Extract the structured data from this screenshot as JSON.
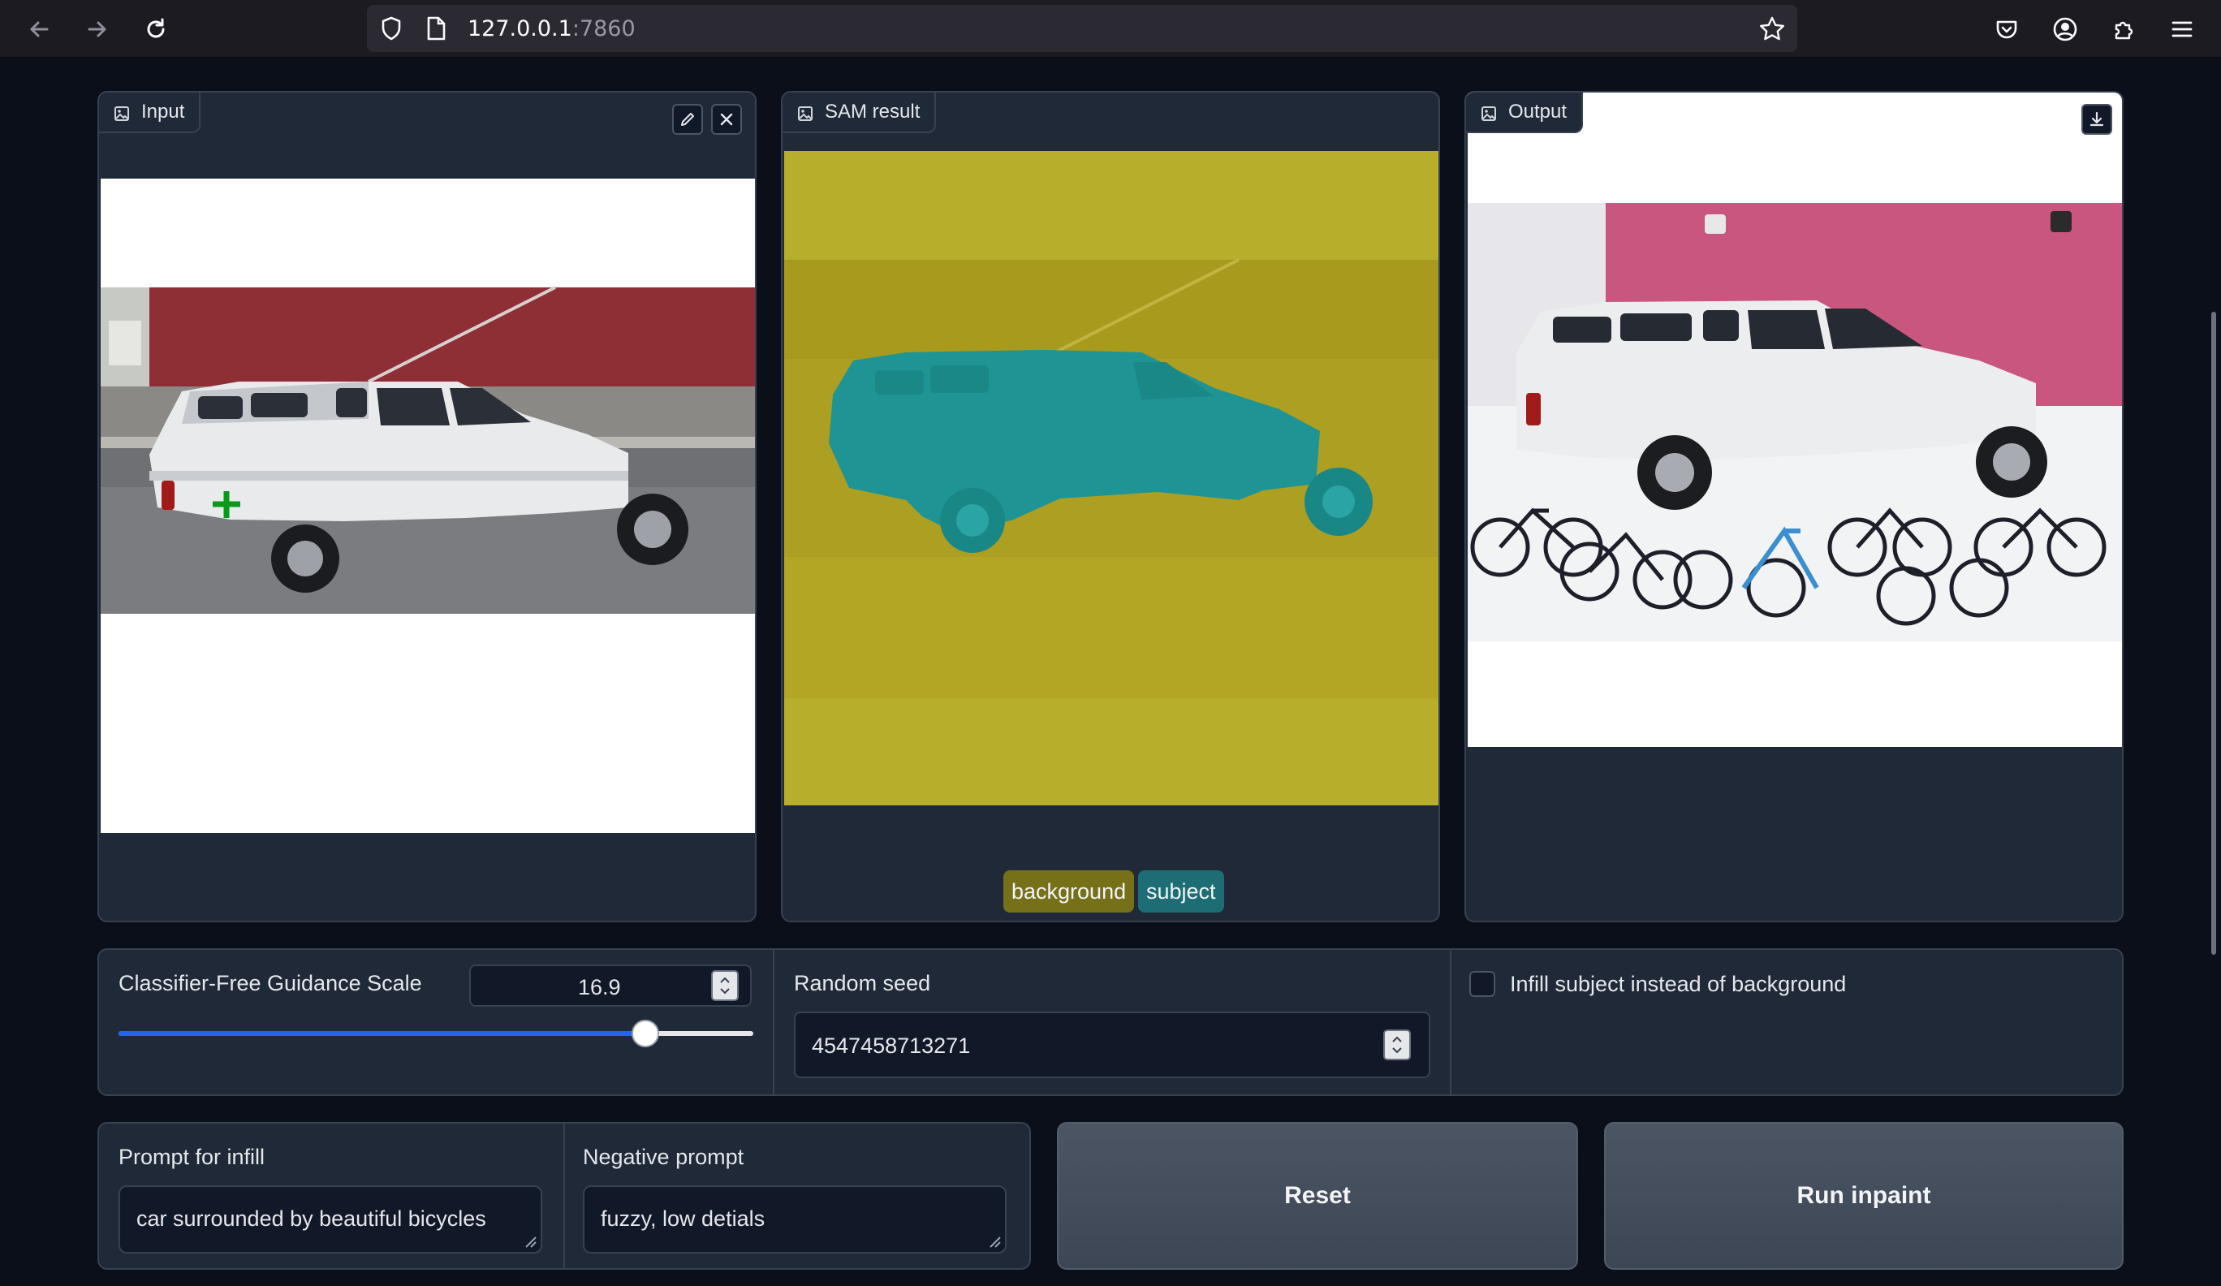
{
  "browser": {
    "url_host": "127.0.0.1",
    "url_port": ":7860"
  },
  "panels": {
    "input": {
      "label": "Input"
    },
    "sam": {
      "label": "SAM result",
      "legend": [
        {
          "label": "background",
          "color": "#767019"
        },
        {
          "label": "subject",
          "color": "#1c6e74"
        }
      ]
    },
    "output": {
      "label": "Output"
    }
  },
  "controls": {
    "guidance": {
      "label": "Classifier-Free Guidance Scale",
      "value": "16.9",
      "slider_fraction": 0.83
    },
    "seed": {
      "label": "Random seed",
      "value": "4547458713271"
    },
    "infill_subject": {
      "label": "Infill subject instead of background",
      "checked": false
    }
  },
  "prompts": {
    "infill": {
      "label": "Prompt for infill",
      "value": "car surrounded by beautiful bicycles"
    },
    "negative": {
      "label": "Negative prompt",
      "value": "fuzzy, low detials"
    }
  },
  "buttons": {
    "reset": "Reset",
    "run": "Run inpaint"
  },
  "colors": {
    "page_bg": "#0b0f19",
    "panel_bg": "#1f2937",
    "slider_accent": "#2563eb",
    "sam_background": "#b7ae2c",
    "sam_subject": "#1e9494"
  }
}
